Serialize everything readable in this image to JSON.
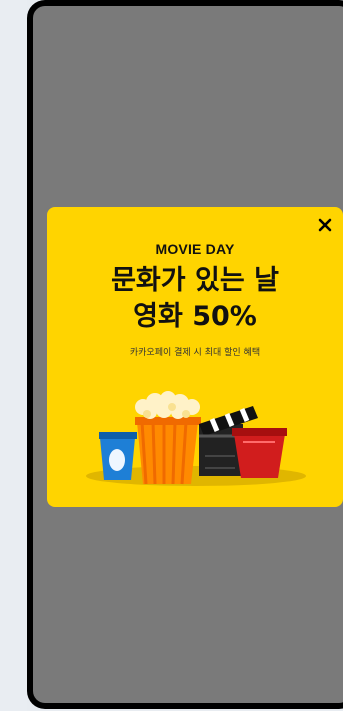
{
  "popup": {
    "eyebrow": "MOVIE DAY",
    "title_line1": "문화가 있는 날",
    "title_line2": "영화 50%",
    "subtitle": "카카오페이 결제 시 최대 할인 혜택",
    "close_label": "×"
  },
  "colors": {
    "overlay": "#7a7a7a",
    "popup_bg": "#ffd400",
    "text": "#111111"
  },
  "icons": {
    "close": "close-icon",
    "illustration": "cinema-snacks-illustration"
  }
}
